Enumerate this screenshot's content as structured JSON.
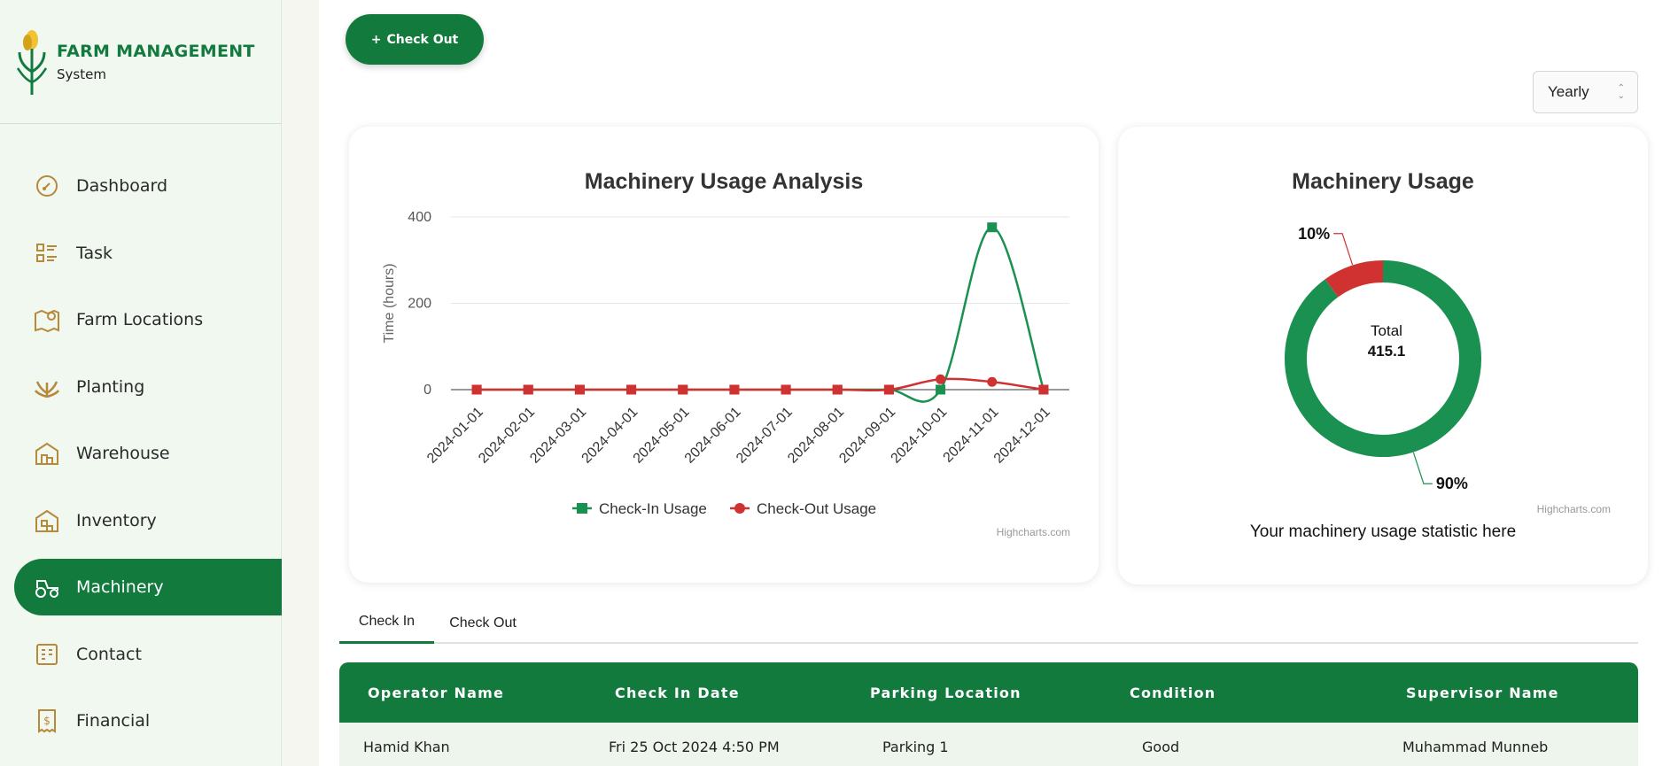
{
  "brand": {
    "title": "FARM MANAGEMENT",
    "subtitle": "System"
  },
  "sidebar": {
    "items": [
      {
        "label": "Dashboard",
        "icon": "speedometer-icon"
      },
      {
        "label": "Task",
        "icon": "task-list-icon"
      },
      {
        "label": "Farm Locations",
        "icon": "map-pin-icon"
      },
      {
        "label": "Planting",
        "icon": "plant-icon"
      },
      {
        "label": "Warehouse",
        "icon": "warehouse-icon"
      },
      {
        "label": "Inventory",
        "icon": "inventory-icon"
      },
      {
        "label": "Machinery",
        "icon": "tractor-icon",
        "active": true
      },
      {
        "label": "Contact",
        "icon": "contact-book-icon"
      },
      {
        "label": "Financial",
        "icon": "receipt-dollar-icon"
      }
    ]
  },
  "toolbar": {
    "checkout_label": "Check Out",
    "period_select": "Yearly"
  },
  "colors": {
    "primary": "#117a3c",
    "checkin": "#1a9150",
    "checkout": "#d03232",
    "sidebar_bg": "#f1f8f0"
  },
  "charts": {
    "analysis_credit": "Highcharts.com",
    "usage_credit": "Highcharts.com",
    "usage_caption": "Your machinery usage statistic here",
    "usage_center_label": "Total",
    "usage_center_value": "415.1"
  },
  "chart_data": [
    {
      "type": "line",
      "title": "Machinery Usage Analysis",
      "xlabel": "",
      "ylabel": "Time (hours)",
      "ylim": [
        0,
        400
      ],
      "yticks": [
        0,
        200,
        400
      ],
      "grid": true,
      "legend": "bottom",
      "x": [
        "2024-01-01",
        "2024-02-01",
        "2024-03-01",
        "2024-04-01",
        "2024-05-01",
        "2024-06-01",
        "2024-07-01",
        "2024-08-01",
        "2024-09-01",
        "2024-10-01",
        "2024-11-01",
        "2024-12-01"
      ],
      "series": [
        {
          "name": "Check-In Usage",
          "color": "#1a9150",
          "marker": "square",
          "values": [
            0,
            0,
            0,
            0,
            0,
            0,
            0,
            0,
            0,
            0,
            376,
            0
          ]
        },
        {
          "name": "Check-Out Usage",
          "color": "#d03232",
          "marker": "circle",
          "values": [
            0,
            0,
            0,
            0,
            0,
            0,
            0,
            0,
            0,
            24,
            18,
            0
          ]
        }
      ]
    },
    {
      "type": "pie",
      "title": "Machinery Usage",
      "donut": true,
      "slices": [
        {
          "label": "90%",
          "value": 90,
          "color": "#1a9150"
        },
        {
          "label": "10%",
          "value": 10,
          "color": "#d03232"
        }
      ]
    }
  ],
  "tabs": [
    {
      "label": "Check In",
      "active": true
    },
    {
      "label": "Check Out",
      "active": false
    }
  ],
  "table": {
    "columns": [
      "Operator Name",
      "Check In Date",
      "Parking Location",
      "Condition",
      "Supervisor Name"
    ],
    "rows": [
      [
        "Hamid Khan",
        "Fri 25 Oct 2024 4:50 PM",
        "Parking 1",
        "Good",
        "Muhammad Munneb"
      ]
    ]
  }
}
